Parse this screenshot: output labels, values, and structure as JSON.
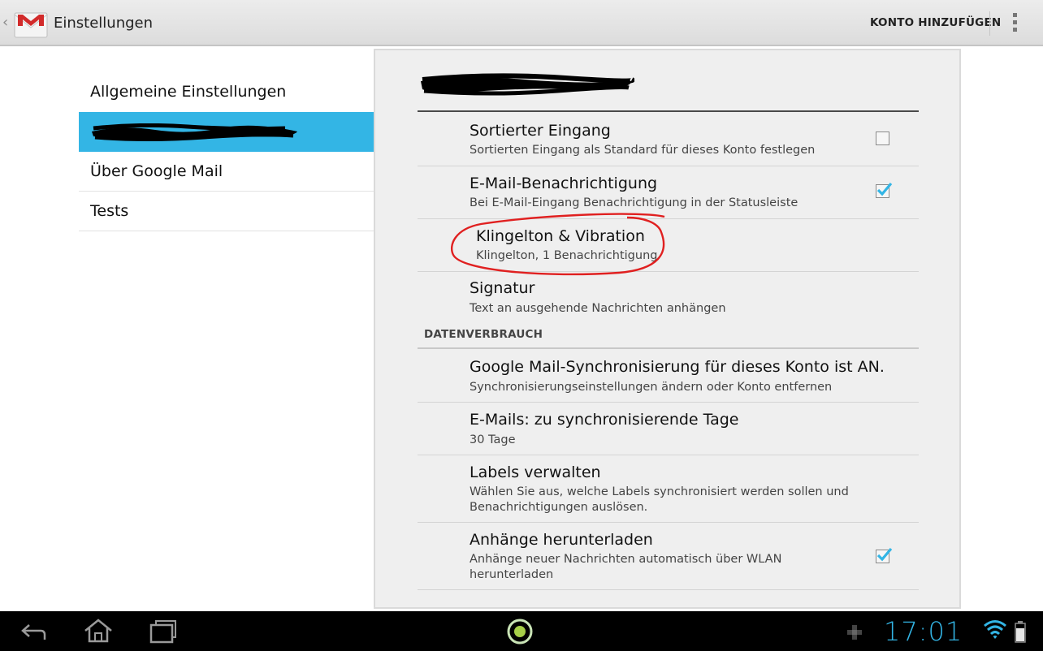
{
  "actionbar": {
    "title": "Einstellungen",
    "add_account_label": "KONTO HINZUFÜGEN",
    "app_icon": "gmail-envelope-icon",
    "menu_icon": "overflow-menu-icon"
  },
  "nav": {
    "items": [
      {
        "label": "Allgemeine Einstellungen"
      },
      {
        "label": "",
        "redacted": true,
        "selected": true
      },
      {
        "label": "Über Google Mail"
      },
      {
        "label": "Tests"
      }
    ]
  },
  "settings": {
    "account_redacted": true,
    "rows": [
      {
        "title": "Sortierter Eingang",
        "summary": "Sortierten Eingang als Standard für dieses Konto festlegen",
        "checked": false
      },
      {
        "title": "E-Mail-Benachrichtigung",
        "summary": "Bei E-Mail-Eingang Benachrichtigung in der Statusleiste",
        "checked": true
      },
      {
        "title": "Klingelton & Vibration",
        "summary": "Klingelton, 1 Benachrichtigung",
        "annotated": true
      },
      {
        "title": "Signatur",
        "summary": "Text an ausgehende Nachrichten anhängen"
      }
    ],
    "section_header": "DATENVERBRAUCH",
    "data_rows": [
      {
        "title": "Google Mail-Synchronisierung für dieses Konto ist AN.",
        "summary": "Synchronisierungseinstellungen ändern oder Konto entfernen"
      },
      {
        "title": "E-Mails: zu synchronisierende Tage",
        "summary": "30 Tage"
      },
      {
        "title": "Labels verwalten",
        "summary": "Wählen Sie aus, welche Labels synchronisiert werden sollen und Benachrichtigungen auslösen."
      },
      {
        "title": "Anhänge herunterladen",
        "summary": "Anhänge neuer Nachrichten automatisch über WLAN herunterladen",
        "checked": true
      }
    ]
  },
  "systembar": {
    "clock": "17:01",
    "icons": [
      "back-icon",
      "home-icon",
      "recent-apps-icon",
      "menu-circle-icon",
      "notification-icon",
      "wifi-icon",
      "battery-icon"
    ]
  },
  "colors": {
    "accent": "#33b5e5",
    "annotation": "#e02020",
    "pane_bg": "#efefef"
  }
}
